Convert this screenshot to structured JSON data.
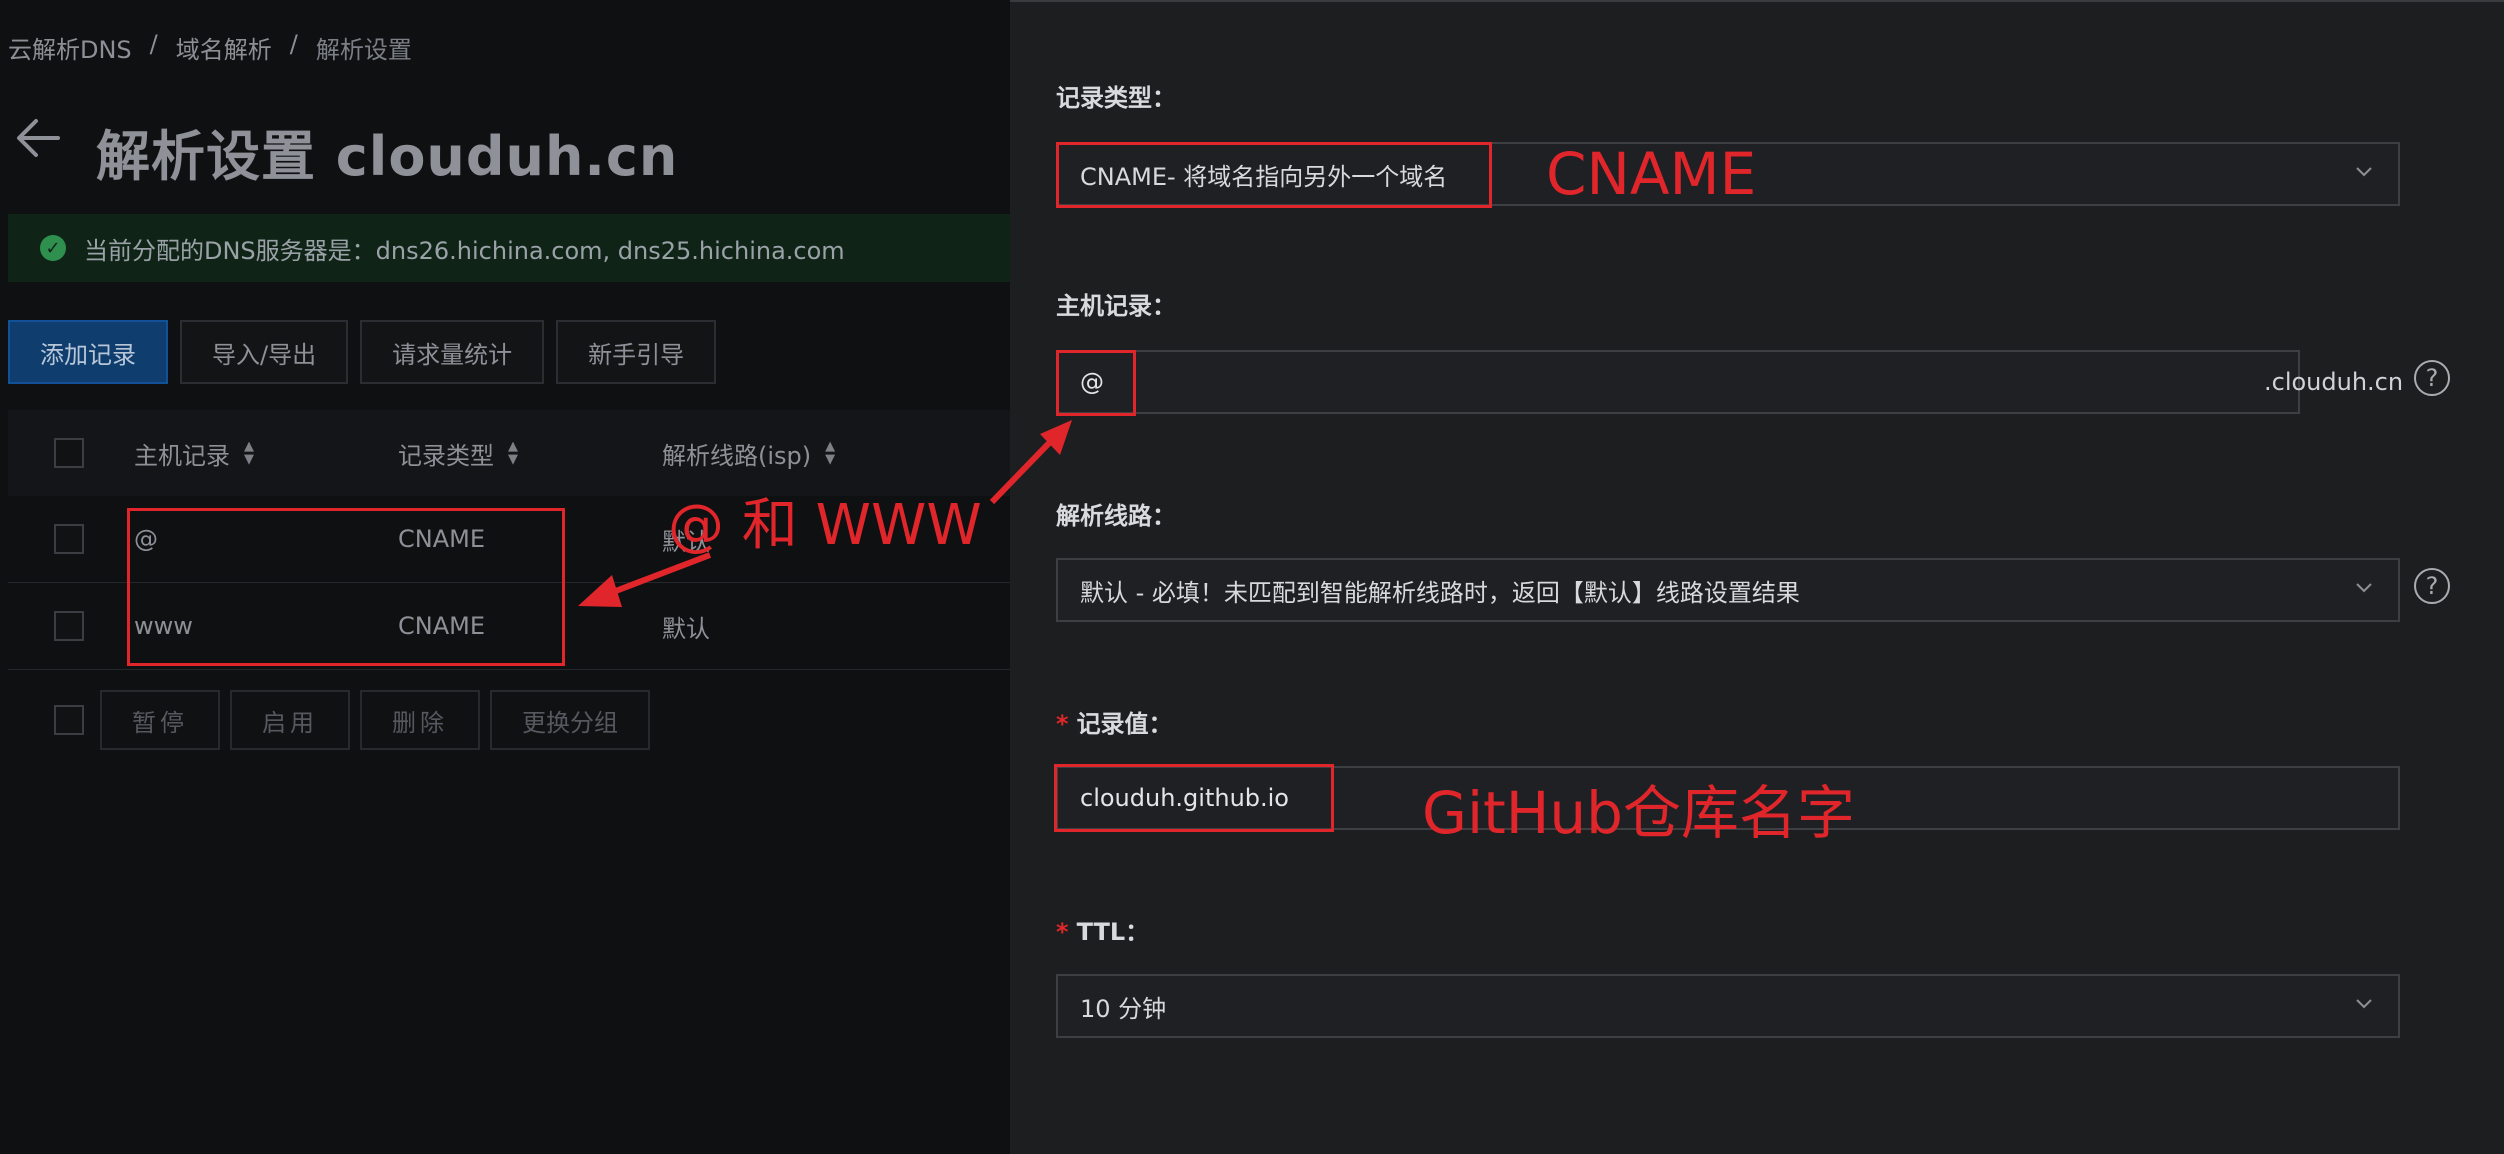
{
  "breadcrumb": [
    "云解析DNS",
    "域名解析",
    "解析设置"
  ],
  "breadcrumb_sep": "/",
  "page_title": "解析设置 clouduh.cn",
  "dns_banner": "当前分配的DNS服务器是：dns26.hichina.com, dns25.hichina.com",
  "toolbar": {
    "add": "添加记录",
    "import_export": "导入/导出",
    "stats": "请求量统计",
    "guide": "新手引导"
  },
  "table": {
    "headers": [
      "主机记录",
      "记录类型",
      "解析线路(isp)"
    ],
    "rows": [
      {
        "host": "@",
        "type": "CNAME",
        "line": "默认"
      },
      {
        "host": "www",
        "type": "CNAME",
        "line": "默认"
      }
    ],
    "bulk_actions": [
      "暂停",
      "启用",
      "删除",
      "更换分组"
    ]
  },
  "form": {
    "record_type_label": "记录类型：",
    "record_type_value": "CNAME- 将域名指向另外一个域名",
    "host_label": "主机记录：",
    "host_value": "@",
    "host_suffix": ".clouduh.cn",
    "line_label": "解析线路：",
    "line_value": "默认 - 必填！未匹配到智能解析线路时，返回【默认】线路设置结果",
    "value_label": "记录值：",
    "value_value": "clouduh.github.io",
    "ttl_label": "TTL：",
    "ttl_value": "10 分钟",
    "required_mark": "*"
  },
  "annotations": {
    "cname": "CNAME",
    "at_www": "@ 和 WWW",
    "github": "GitHub仓库名字"
  },
  "colors": {
    "annotation_red": "#e0262b",
    "primary_blue": "#0f3d6e",
    "success_green": "#2f8f4e"
  }
}
